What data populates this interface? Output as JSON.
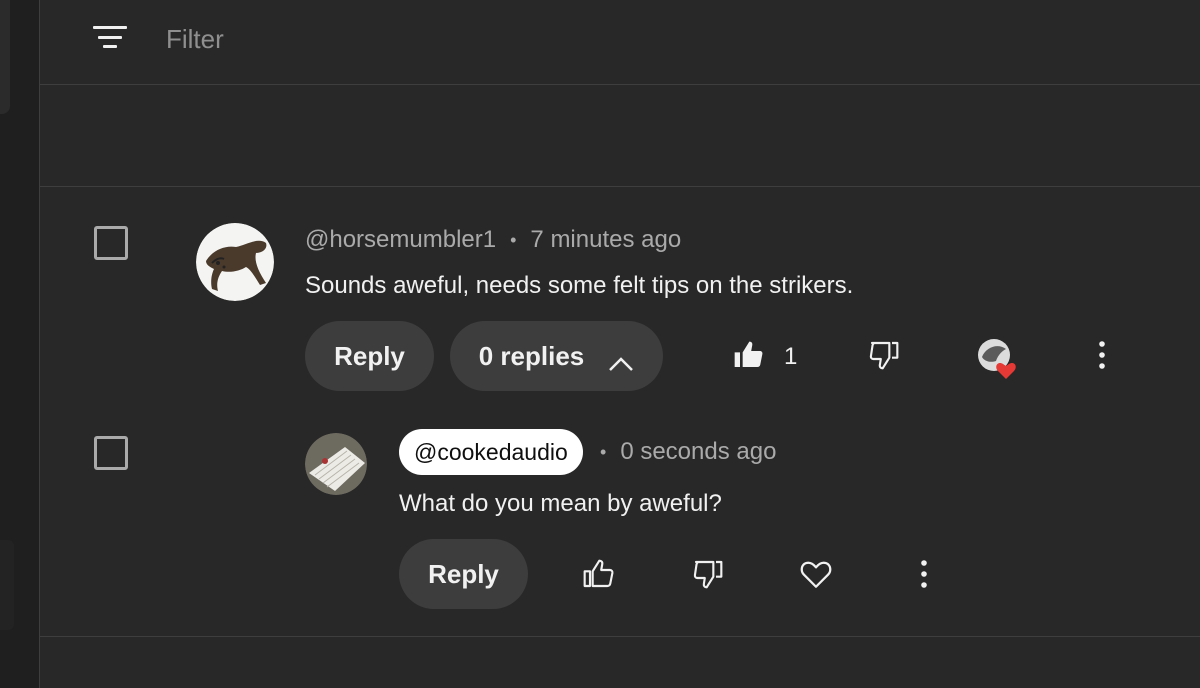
{
  "filter": {
    "icon": "filter-icon",
    "label": "Filter"
  },
  "comments": [
    {
      "handle": "@horsemumbler1",
      "time": "7 minutes ago",
      "text": "Sounds aweful, needs some felt tips on the strikers.",
      "reply_label": "Reply",
      "replies_label": "0 replies",
      "like_count": "1",
      "liked": true,
      "creator_heart": true
    },
    {
      "handle": "@cookedaudio",
      "time": "0 seconds ago",
      "text": "What do you mean by aweful?",
      "reply_label": "Reply",
      "is_owner_reply": true
    }
  ],
  "colors": {
    "background": "#282828",
    "pill": "#3d3d3d",
    "heart": "#e53935",
    "muted_text": "#aaaaaa"
  }
}
